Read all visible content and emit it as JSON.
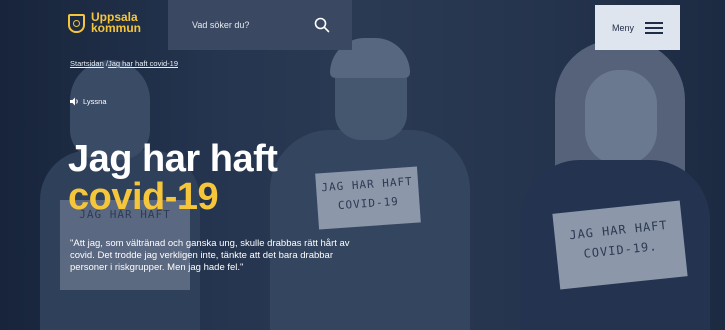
{
  "header": {
    "logo_line1": "Uppsala",
    "logo_line2": "kommun",
    "search_placeholder": "Vad söker du?",
    "menu_label": "Meny"
  },
  "breadcrumb": {
    "home": "Startsidan",
    "separator": " /",
    "current": "Jag har haft covid-19"
  },
  "listen_label": "Lyssna",
  "hero": {
    "title_line1": "Jag har haft",
    "title_line2": "covid-19",
    "quote": "\"Att jag, som vältränad och ganska ung, skulle drabbas rätt hårt av covid. Det trodde jag verkligen inte, tänkte att det bara drabbar personer i riskgrupper. Men jag hade fel.\""
  },
  "signs": {
    "mid_line1": "JAG HAR HAFT",
    "mid_line2": "COVID-19",
    "right_line1": "JAG HAR HAFT",
    "right_line2": "COVID-19.",
    "left_line1": "JAG HAR HAFT"
  },
  "colors": {
    "accent": "#f6c63a",
    "overlay": "#1e2c45",
    "search_bg": "#3a4862",
    "menu_bg": "#dfe5ee"
  },
  "icons": {
    "logo": "uppsala-crest-icon",
    "search": "search-icon",
    "menu": "hamburger-icon",
    "listen": "speaker-icon"
  }
}
